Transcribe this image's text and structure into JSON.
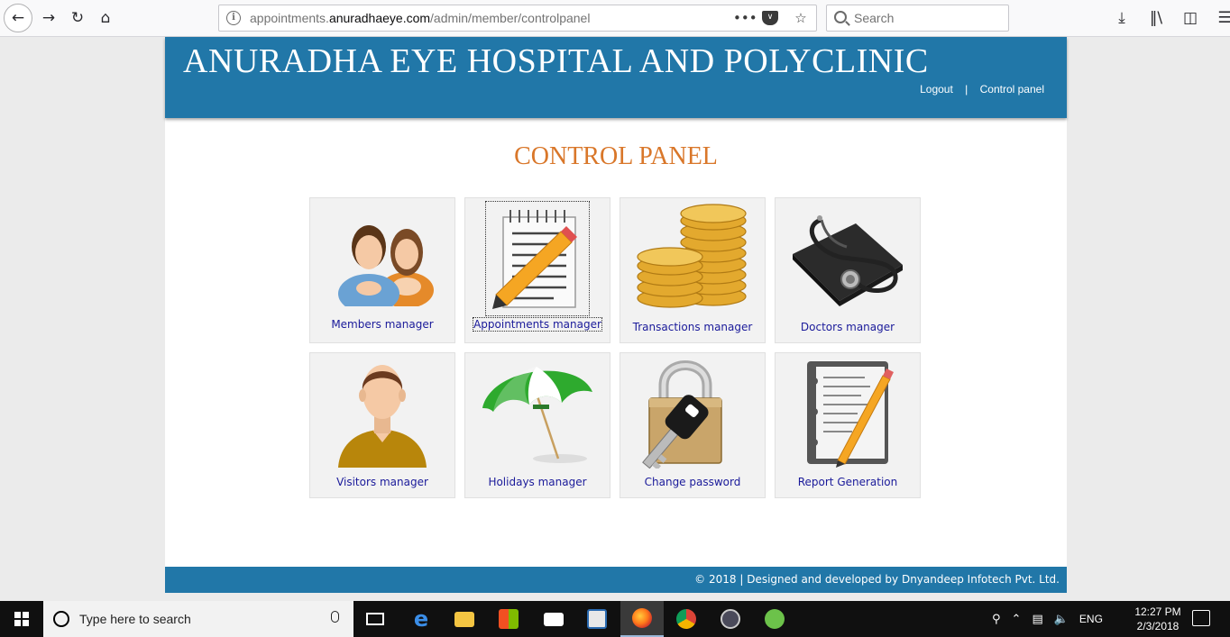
{
  "browser": {
    "url_prefix": "appointments.",
    "url_domain": "anuradhaeye.com",
    "url_path": "/admin/member/controlpanel",
    "search_placeholder": "Search"
  },
  "header": {
    "title": "ANURADHA EYE HOSPITAL AND POLYCLINIC",
    "logout_label": "Logout",
    "separator": "|",
    "control_panel_label": "Control panel"
  },
  "main": {
    "heading": "CONTROL PANEL",
    "tiles": [
      {
        "label": "Members manager",
        "icon": "members-icon"
      },
      {
        "label": "Appointments manager",
        "icon": "notepad-pencil-icon"
      },
      {
        "label": "Transactions manager",
        "icon": "coins-icon"
      },
      {
        "label": "Doctors manager",
        "icon": "stethoscope-icon"
      },
      {
        "label": "Visitors manager",
        "icon": "visitor-icon"
      },
      {
        "label": "Holidays manager",
        "icon": "umbrella-icon"
      },
      {
        "label": "Change password",
        "icon": "padlock-key-icon"
      },
      {
        "label": "Report Generation",
        "icon": "report-icon"
      }
    ]
  },
  "footer": {
    "text": "© 2018 | Designed and developed by Dnyandeep Infotech Pvt. Ltd."
  },
  "taskbar": {
    "search_placeholder": "Type here to search",
    "language": "ENG",
    "time": "12:27 PM",
    "date": "2/3/2018"
  },
  "colors": {
    "header_blue": "#2177a8",
    "heading_orange": "#d9772a",
    "link_blue": "#1a1a9a"
  }
}
